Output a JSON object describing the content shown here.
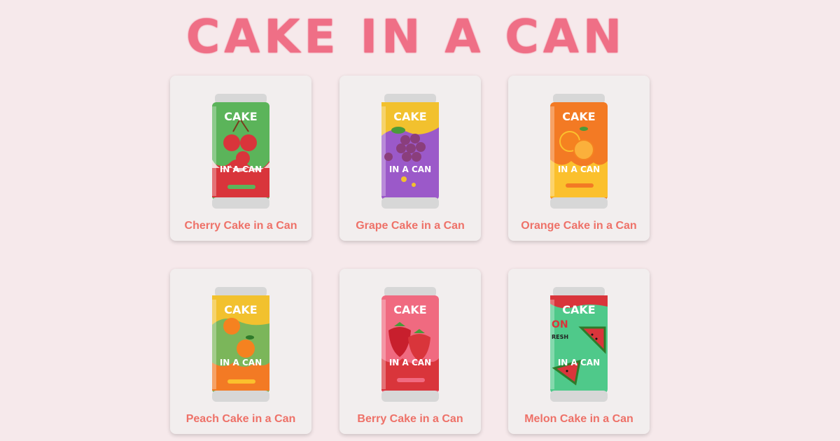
{
  "header": {
    "title": "CAKE IN A CAN"
  },
  "products": [
    {
      "name": "Cherry Cake in a Can",
      "can_top_text": "CAKE",
      "can_bottom_text": "IN A CAN",
      "primary_color": "#5bb45a",
      "accent_color": "#d9353b",
      "fruit_icon": "cherry-icon"
    },
    {
      "name": "Grape Cake in a Can",
      "can_top_text": "CAKE",
      "can_bottom_text": "IN A CAN",
      "primary_color": "#9b59c9",
      "accent_color": "#f2c12e",
      "fruit_icon": "grape-icon"
    },
    {
      "name": "Orange Cake in a Can",
      "can_top_text": "CAKE",
      "can_bottom_text": "IN A CAN",
      "primary_color": "#f37a24",
      "accent_color": "#fbc02d",
      "fruit_icon": "orange-icon"
    },
    {
      "name": "Peach Cake in a Can",
      "can_top_text": "CAKE",
      "can_bottom_text": "IN A CAN",
      "primary_color": "#7bb65a",
      "accent_color": "#f37a24",
      "fruit_icon": "peach-icon"
    },
    {
      "name": "Berry Cake in a Can",
      "can_top_text": "CAKE",
      "can_bottom_text": "IN A CAN",
      "primary_color": "#f06a80",
      "accent_color": "#d9353b",
      "fruit_icon": "strawberry-icon"
    },
    {
      "name": "Melon Cake in a Can",
      "can_top_text": "CAKE",
      "can_bottom_text": "IN A CAN",
      "side_text_1": "ON",
      "side_text_2": "RESH",
      "primary_color": "#4fc98a",
      "accent_color": "#d9353b",
      "fruit_icon": "watermelon-icon"
    }
  ]
}
